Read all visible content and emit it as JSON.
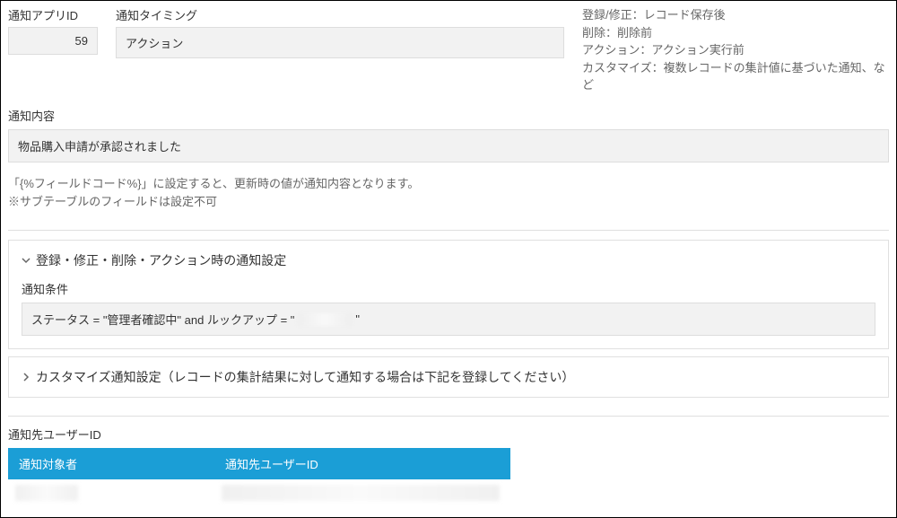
{
  "top": {
    "app_id_label": "通知アプリID",
    "app_id_value": "59",
    "timing_label": "通知タイミング",
    "timing_value": "アクション",
    "info1": "登録/修正：レコード保存後",
    "info2": "削除：削除前",
    "info3": "アクション：アクション実行前",
    "info4": "カスタマイズ：複数レコードの集計値に基づいた通知、など"
  },
  "content": {
    "label": "通知内容",
    "value": "物品購入申請が承認されました",
    "hint1": "「{%フィールドコード%}」に設定すると、更新時の値が通知内容となります。",
    "hint2": "※サブテーブルのフィールドは設定不可"
  },
  "accordion1": {
    "title": "登録・修正・削除・アクション時の通知設定",
    "cond_label": "通知条件",
    "cond_pre": "ステータス = \"管理者確認中\" and ルックアップ = \"",
    "cond_suf": "\""
  },
  "accordion2": {
    "title": "カスタマイズ通知設定（レコードの集計結果に対して通知する場合は下記を登録してください）"
  },
  "table": {
    "section_label": "通知先ユーザーID",
    "col1": "通知対象者",
    "col2": "通知先ユーザーID"
  }
}
